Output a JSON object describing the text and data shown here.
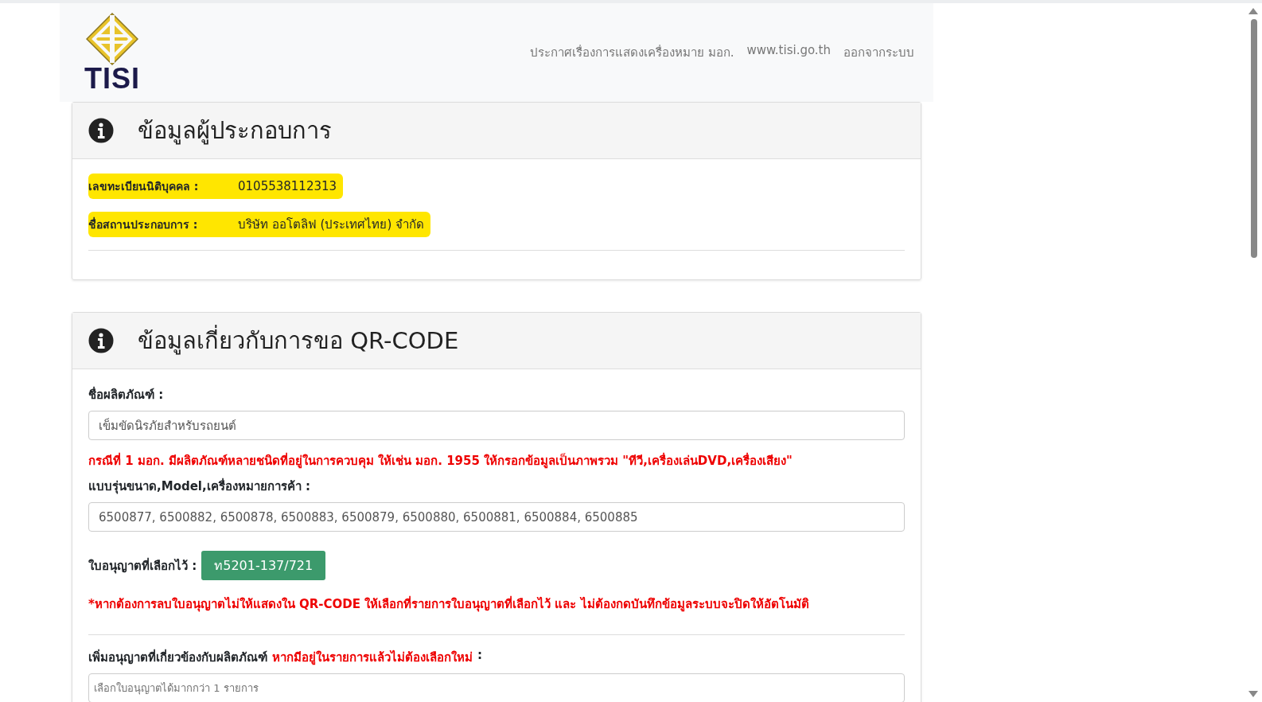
{
  "header": {
    "logo_text": "TISI",
    "nav": [
      {
        "label": "ประกาศเรื่องการแสดงเครื่องหมาย มอก."
      },
      {
        "label": "www.tisi.go.th"
      },
      {
        "label": "ออกจากระบบ"
      }
    ]
  },
  "operator_card": {
    "title": "ข้อมูลผู้ประกอบการ",
    "rows": [
      {
        "label": "เลขทะเบียนนิติบุคคล :",
        "value": "0105538112313",
        "highlighted": true
      },
      {
        "label": "ชื่อสถานประกอบการ :",
        "value": "บริษัท ออโตลิฟ (ประเทศไทย) จำกัด",
        "highlighted": true
      }
    ]
  },
  "qr_card": {
    "title": "ข้อมูลเกี่ยวกับการขอ QR-CODE",
    "product_label": "ชื่อผลิตภัณฑ์ :",
    "product_value": "เข็มขัดนิรภัยสำหรับรถยนต์",
    "product_note": "กรณีที่ 1 มอก. มีผลิตภัณฑ์หลายชนิดที่อยู่ในการควบคุม ให้เช่น มอก. 1955 ให้กรอกข้อมูลเป็นภาพรวม \"ทีวี,เครื่องเล่นDVD,เครื่องเสียง\"",
    "model_label": "แบบรุ่นขนาด,**Model**,เครื่องหมายการค้า :",
    "model_value": "6500877, 6500882, 6500878, 6500883, 6500879, 6500880, 6500881, 6500884, 6500885",
    "selected_label": "ใบอนุญาตที่เลือกไว้ :",
    "selected_licenses": [
      "ท5201-137/721"
    ],
    "remove_note": "*หากต้องการลบใบอนุญาตไม่ให้แสดงใน QR-CODE ให้เลือกที่รายการใบอนุญาตที่เลือกไว้ และ ไม่ต้องกดบันทึกข้อมูลระบบจะปิดให้อัตโนมัติ",
    "add_label": "เพิ่มอนุญาตที่เกี่ยวข้องกับผลิตภัณฑ์",
    "add_label_note": "หากมีอยู่ในรายการแล้วไม่ต้องเลือกใหม่",
    "add_label_colon": ":",
    "add_placeholder": "เลือกใบอนุญาตได้มากกว่า 1 รายการ"
  }
}
